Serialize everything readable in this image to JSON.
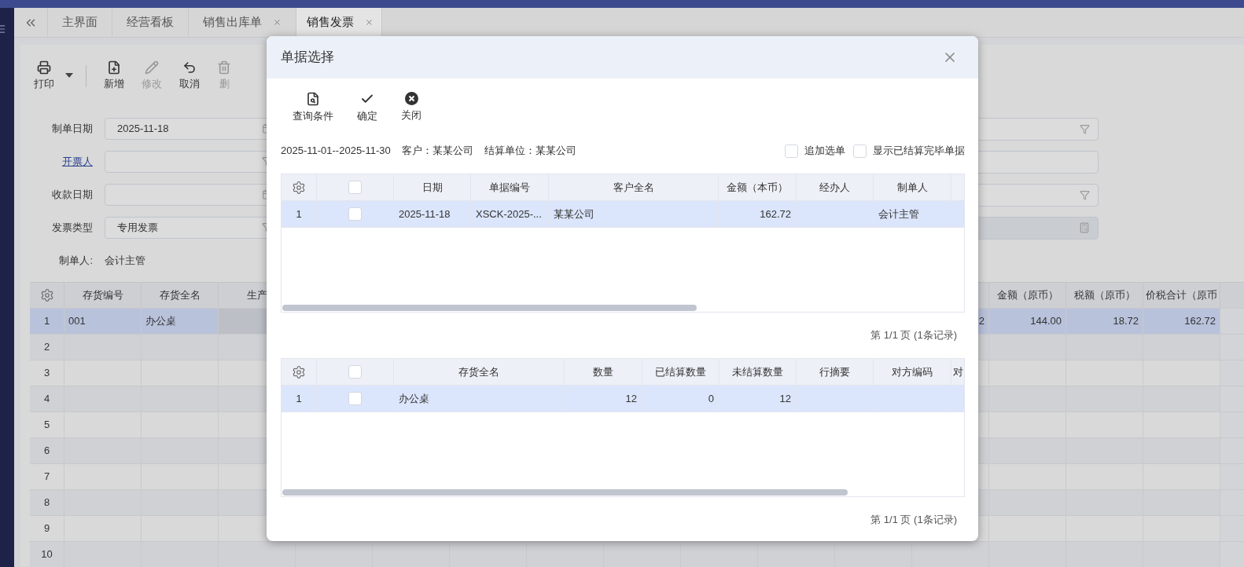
{
  "tabs": [
    {
      "label": "主界面",
      "selected": false,
      "closable": false
    },
    {
      "label": "经营看板",
      "selected": false,
      "closable": false
    },
    {
      "label": "销售出库单",
      "selected": false,
      "closable": true
    },
    {
      "label": "销售发票",
      "selected": true,
      "closable": true
    }
  ],
  "toolbar": [
    {
      "label": "打印",
      "kind": "print",
      "disabled": false
    },
    {
      "label": "新增",
      "kind": "add",
      "disabled": false
    },
    {
      "label": "修改",
      "kind": "edit",
      "disabled": true
    },
    {
      "label": "取消",
      "kind": "undo",
      "disabled": false
    },
    {
      "label": "删",
      "kind": "delete",
      "disabled": true
    }
  ],
  "form_left": [
    {
      "label": "制单日期",
      "kind": "date",
      "value": "2025-11-18",
      "link": false
    },
    {
      "label": "开票人",
      "kind": "filter",
      "link": true
    },
    {
      "label": "收款日期",
      "kind": "date",
      "link": false
    },
    {
      "label": "发票类型",
      "kind": "filter",
      "value": "专用发票",
      "link": false
    },
    {
      "label": "制单人:",
      "kind": "text",
      "value": "会计主管",
      "link": false
    }
  ],
  "form_right": [
    {
      "kind": "filter",
      "disabled": false
    },
    {
      "kind": "plain",
      "disabled": false
    },
    {
      "kind": "filter",
      "disabled": false
    },
    {
      "kind": "calc",
      "disabled": true
    }
  ],
  "grid": {
    "columns_left": [
      "存货编号",
      "存货全名",
      "生产"
    ],
    "columns_right": [
      "金额（原币）",
      "税额（原币）",
      "价税合计（原币"
    ],
    "rows": [
      {
        "index": "1",
        "selected": true,
        "code": "001",
        "name": "办公桌",
        "column_hidden": "2",
        "amount": "144.00",
        "tax": "18.72",
        "total": "162.72"
      },
      {
        "index": "2",
        "selected": false
      },
      {
        "index": "3",
        "selected": false
      },
      {
        "index": "4",
        "selected": false
      },
      {
        "index": "5",
        "selected": false
      },
      {
        "index": "6",
        "selected": false
      },
      {
        "index": "7",
        "selected": false
      },
      {
        "index": "8",
        "selected": false
      },
      {
        "index": "9",
        "selected": false
      },
      {
        "index": "10",
        "selected": false
      }
    ]
  },
  "dialog": {
    "title": "单据选择",
    "toolbar": [
      {
        "label": "查询条件",
        "kind": "query"
      },
      {
        "label": "确定",
        "kind": "ok"
      },
      {
        "label": "关闭",
        "kind": "close"
      }
    ],
    "filter_info": [
      "2025-11-01--2025-11-30",
      "客户：某某公司",
      "结算单位：某某公司"
    ],
    "options": [
      {
        "label": "追加选单",
        "checked": false
      },
      {
        "label": "显示已结算完毕单据",
        "checked": false
      }
    ],
    "bills": {
      "all_checked": false,
      "columns": [
        "日期",
        "单据编号",
        "客户全名",
        "金额（本币）",
        "经办人",
        "制单人"
      ],
      "rows": [
        {
          "index": "1",
          "selected": true,
          "checked": false,
          "date": "2025-11-18",
          "number": "XSCK-2025-...",
          "customer": "某某公司",
          "amount": "162.72",
          "creator": "会计主管"
        }
      ],
      "pagination": "第 1/1 页 (1条记录)"
    },
    "items": {
      "all_checked": false,
      "columns": [
        "存货全名",
        "数量",
        "已结算数量",
        "未结算数量",
        "行摘要",
        "对方编码",
        "对"
      ],
      "rows": [
        {
          "index": "1",
          "selected": true,
          "checked": false,
          "name": "办公桌",
          "qty": "12",
          "settled": "0",
          "unsettled": "12"
        }
      ],
      "pagination": "第 1/1 页 (1条记录)"
    }
  }
}
